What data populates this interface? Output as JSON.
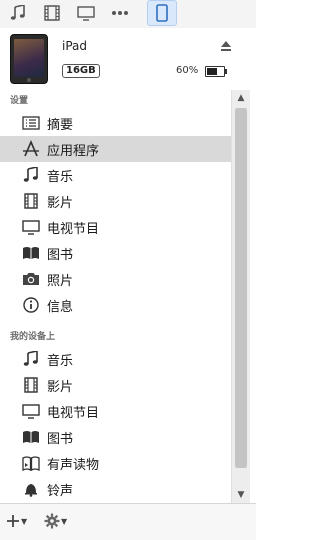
{
  "toolbar": {
    "buttons": [
      "music-icon",
      "movies-icon",
      "tv-icon",
      "more-icon",
      "device-icon"
    ]
  },
  "device": {
    "name": "iPad",
    "capacity": "16GB",
    "battery_percent": "60%",
    "battery_level": 0.6
  },
  "sections": [
    {
      "title": "设置",
      "items": [
        {
          "label": "摘要",
          "icon": "summary-icon",
          "selected": false
        },
        {
          "label": "应用程序",
          "icon": "apps-icon",
          "selected": true
        },
        {
          "label": "音乐",
          "icon": "music-icon",
          "selected": false
        },
        {
          "label": "影片",
          "icon": "movies-icon",
          "selected": false
        },
        {
          "label": "电视节目",
          "icon": "tv-icon",
          "selected": false
        },
        {
          "label": "图书",
          "icon": "books-icon",
          "selected": false
        },
        {
          "label": "照片",
          "icon": "camera-icon",
          "selected": false
        },
        {
          "label": "信息",
          "icon": "info-icon",
          "selected": false
        }
      ]
    },
    {
      "title": "我的设备上",
      "items": [
        {
          "label": "音乐",
          "icon": "music-icon",
          "selected": false
        },
        {
          "label": "影片",
          "icon": "movies-icon",
          "selected": false
        },
        {
          "label": "电视节目",
          "icon": "tv-icon",
          "selected": false
        },
        {
          "label": "图书",
          "icon": "books-icon",
          "selected": false
        },
        {
          "label": "有声读物",
          "icon": "audiobooks-icon",
          "selected": false
        },
        {
          "label": "铃声",
          "icon": "bell-icon",
          "selected": false
        }
      ]
    }
  ],
  "colors": {
    "selected_row": "#d9d9d9",
    "device_button_bg": "#d9e8fb"
  }
}
